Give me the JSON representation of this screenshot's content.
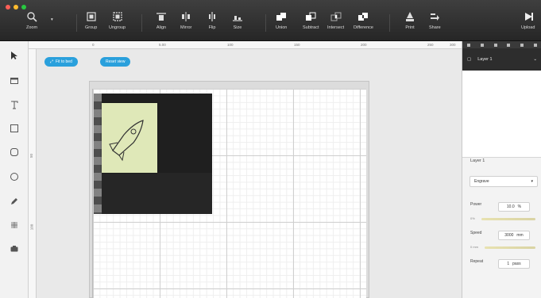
{
  "toolbar": {
    "items": [
      {
        "label": "Zoom",
        "icon": "zoom-icon"
      },
      {
        "label": "Group",
        "icon": "group-icon"
      },
      {
        "label": "Ungroup",
        "icon": "ungroup-icon"
      },
      {
        "label": "Align",
        "icon": "align-icon"
      },
      {
        "label": "Mirror",
        "icon": "mirror-icon"
      },
      {
        "label": "Flip",
        "icon": "flip-icon"
      },
      {
        "label": "Size",
        "icon": "size-icon"
      },
      {
        "label": "Union",
        "icon": "union-icon"
      },
      {
        "label": "Subtract",
        "icon": "subtract-icon"
      },
      {
        "label": "Intersect",
        "icon": "intersect-icon"
      },
      {
        "label": "Difference",
        "icon": "difference-icon"
      },
      {
        "label": "Print",
        "icon": "print-icon"
      },
      {
        "label": "Share",
        "icon": "share-icon"
      },
      {
        "label": "Upload",
        "icon": "upload-icon"
      }
    ]
  },
  "canvas": {
    "chips": [
      {
        "label": "Fit to bed",
        "icon": "expand-icon"
      },
      {
        "label": "Reset view"
      }
    ],
    "ruler_top": [
      "0",
      "5.00",
      "100",
      "150",
      "200",
      "250",
      "300"
    ],
    "ruler_left": [
      "50",
      "100"
    ]
  },
  "panel": {
    "layer_name": "Layer 1",
    "properties_title": "Layer 1",
    "mode_select": "Engrave",
    "power": {
      "label": "Power",
      "value": "10.0",
      "unit": "%",
      "min_label": "0%"
    },
    "speed": {
      "label": "Speed",
      "value": "3000",
      "unit": "mm",
      "min_label": "0 mm"
    },
    "repeat": {
      "label": "Repeat",
      "value": "1",
      "unit": "pass"
    }
  },
  "colors": {
    "accent": "#2aa0dc",
    "toolbar": "#2f2f2f",
    "traffic_red": "#ff5f57",
    "traffic_yellow": "#febc2e",
    "traffic_green": "#28c840"
  }
}
